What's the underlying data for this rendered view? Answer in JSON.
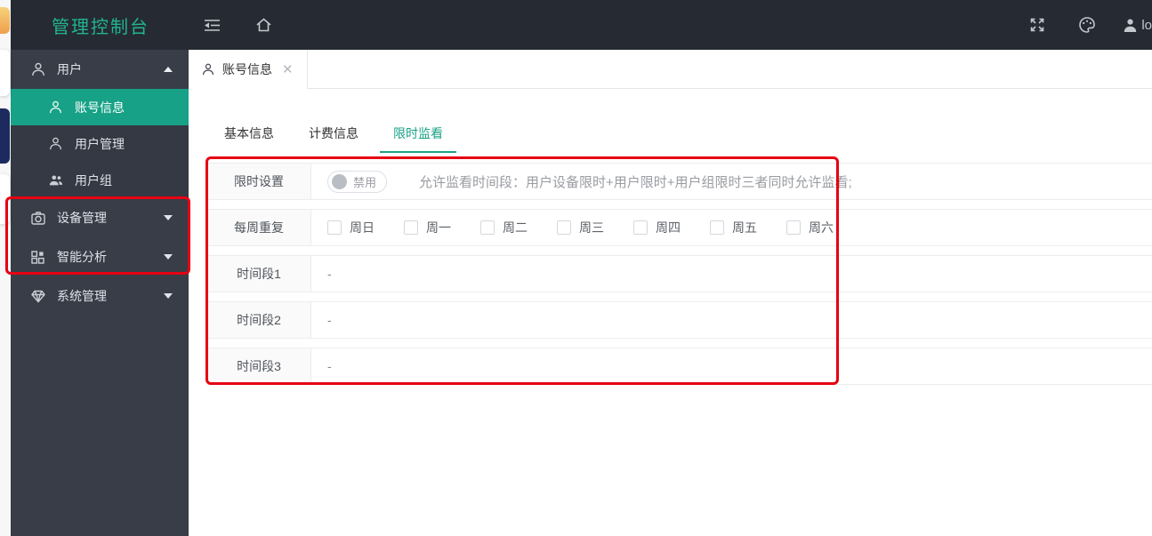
{
  "colors": {
    "accent": "#17a287",
    "title_teal": "#21b491",
    "topbar_bg": "#262b33",
    "sidebar_bg": "#383d47",
    "annotation_red": "#e60012"
  },
  "topbar": {
    "title": "管理控制台",
    "username": "lo"
  },
  "tabbar": {
    "open_tab": "账号信息"
  },
  "sidebar": {
    "items": [
      "用户",
      "账号信息",
      "用户管理",
      "用户组",
      "设备管理",
      "智能分析",
      "系统管理"
    ]
  },
  "subtabs": {
    "items": [
      "基本信息",
      "计费信息",
      "限时监看"
    ],
    "active": "限时监看"
  },
  "form": {
    "limit_row": {
      "label": "限时设置",
      "toggle_label": "禁用",
      "hint": "允许监看时间段：用户设备限时+用户限时+用户组限时三者同时允许监看;"
    },
    "repeat_row": {
      "label": "每周重复",
      "days": [
        "周日",
        "周一",
        "周二",
        "周三",
        "周四",
        "周五",
        "周六"
      ]
    },
    "period_rows": [
      {
        "label": "时间段1",
        "value": "-"
      },
      {
        "label": "时间段2",
        "value": "-"
      },
      {
        "label": "时间段3",
        "value": "-"
      }
    ]
  }
}
